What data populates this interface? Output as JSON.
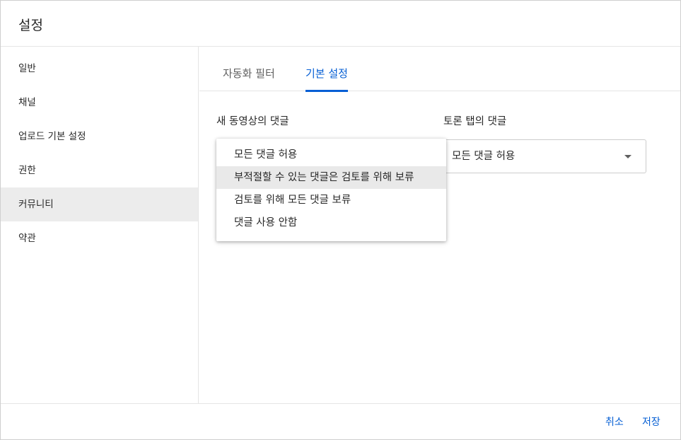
{
  "dialog": {
    "title": "설정"
  },
  "sidebar": {
    "items": [
      {
        "label": "일반"
      },
      {
        "label": "채널"
      },
      {
        "label": "업로드 기본 설정"
      },
      {
        "label": "권한"
      },
      {
        "label": "커뮤니티",
        "active": true
      },
      {
        "label": "약관"
      }
    ]
  },
  "tabs": [
    {
      "label": "자동화 필터"
    },
    {
      "label": "기본 설정",
      "active": true
    }
  ],
  "video_comments": {
    "label": "새 동영상의 댓글",
    "options": [
      "모든 댓글 허용",
      "부적절할 수 있는 댓글은 검토를 위해 보류",
      "검토를 위해 모든 댓글 보류",
      "댓글 사용 안함"
    ],
    "highlighted_option": "부적절할 수 있는 댓글은 검토를 위해 보류"
  },
  "discussion_comments": {
    "label": "토론 탭의 댓글",
    "selected": "모든 댓글 허용"
  },
  "footer": {
    "cancel_label": "취소",
    "save_label": "저장"
  },
  "colors": {
    "accent": "#065fd4",
    "active_background": "#ececec",
    "hover_background": "#e9e9e9"
  }
}
